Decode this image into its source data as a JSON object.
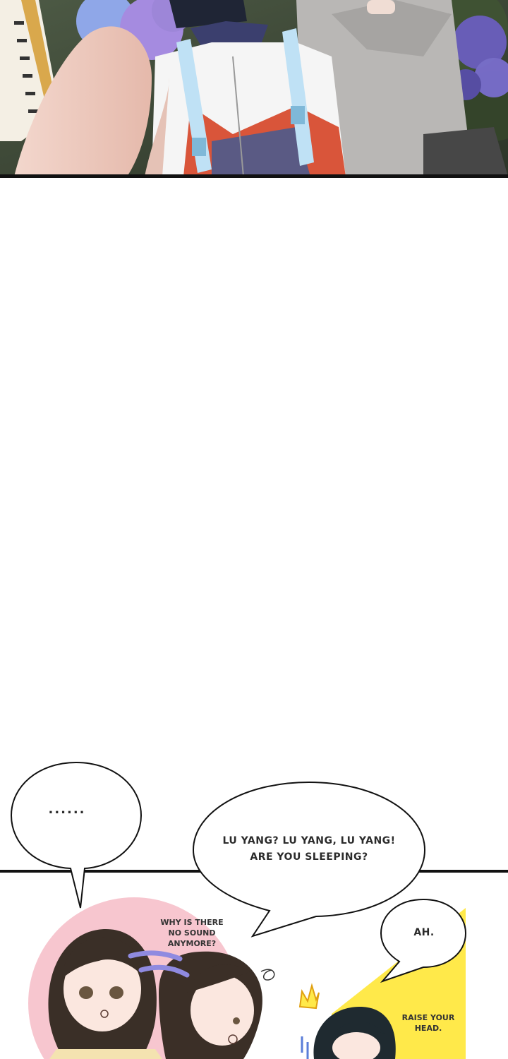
{
  "bubbles": {
    "ellipsis": "......",
    "lu_yang_line1": "LU YANG? LU YANG, LU YANG!",
    "lu_yang_line2": "ARE YOU SLEEPING?",
    "ah": "AH."
  },
  "sfx": {
    "why_line1": "WHY IS THERE",
    "why_line2": "NO SOUND",
    "why_line3": "ANYMORE?",
    "raise_line1": "RAISE YOUR",
    "raise_line2": "HEAD."
  },
  "colors": {
    "panel_border": "#111111",
    "pink_circle": "#f7c6cf",
    "yellow_flash": "#ffe94a",
    "hydrangea": "#8f86e0",
    "hoodie": "#b8b6b4",
    "uniform_red": "#d9553a",
    "uniform_navy": "#3b3f6e"
  }
}
